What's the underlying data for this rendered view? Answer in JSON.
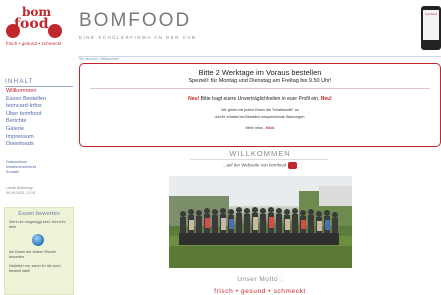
{
  "header": {
    "logo_top": "bom",
    "logo_bottom": "food",
    "logo_slogan": "frisch • gesund • schmeckt",
    "site_title": "BOMFOOD",
    "site_subtitle": "EINE SCHÜLERFIRMA AN DER CVB",
    "phone_label": "bomfood",
    "breadcrumb": "Sie sind hier:  Willkommen"
  },
  "notice": {
    "headline": "Bitte 2 Werktage im Voraus bestellen",
    "subline": "Speziell: für Montag und Dienstag am Freitag bis 9.50 Uhr!",
    "warn_prefix": "Neu!",
    "warn_text": " Bitte tragt euere Unverträglichkeiten in euer Profil ein. ",
    "warn_suffix": "Neu!",
    "small_1": "Wir geben bei jedem Essen die \"Inhaltsstoffe\" an",
    "small_2": "und ihr erhaltet bei Bestellen entsprechende Warnungen.",
    "more_prefix": "Mehr Infos - ",
    "more_link": "Klick"
  },
  "sidebar": {
    "heading": "INHALT",
    "items": [
      {
        "label": "Willkommen",
        "active": true
      },
      {
        "label": "Essen Bestellen",
        "active": false
      },
      {
        "label": "bomcard-Infos",
        "active": false
      },
      {
        "label": "Über bomfood",
        "active": false
      },
      {
        "label": "Berichte",
        "active": false
      },
      {
        "label": "Galerie",
        "active": false
      },
      {
        "label": "Impressum",
        "active": false
      },
      {
        "label": "Downloads",
        "active": false
      }
    ],
    "extra_1": "Datenschutz",
    "extra_2": "Inhaltsverzeichnis",
    "extra_3": "Kontakt",
    "updated_label": "Letzte Änderung:",
    "updated_value": "09.09.2015, 17:15",
    "rate_title": "Essen bewerten",
    "rate_text_1": "Wenn ihr eingeloggt seid, könnt ihr über",
    "rate_text_2": "die Essen der letzten Woche bewerten.",
    "rate_text_3": "Natürlich nur, wenn ihr die auch bestellt habt!"
  },
  "main": {
    "welcome_title": "WILLKOMMEN",
    "welcome_sub": "...auf der Webseite von bomfood",
    "motto_label": "Unser Motto :",
    "motto_words": "frisch • gesund • schmeckt"
  },
  "colors": {
    "brand_red": "#c0262c",
    "nav_blue": "#5468a8",
    "heading_blue": "#6f7fa8"
  }
}
